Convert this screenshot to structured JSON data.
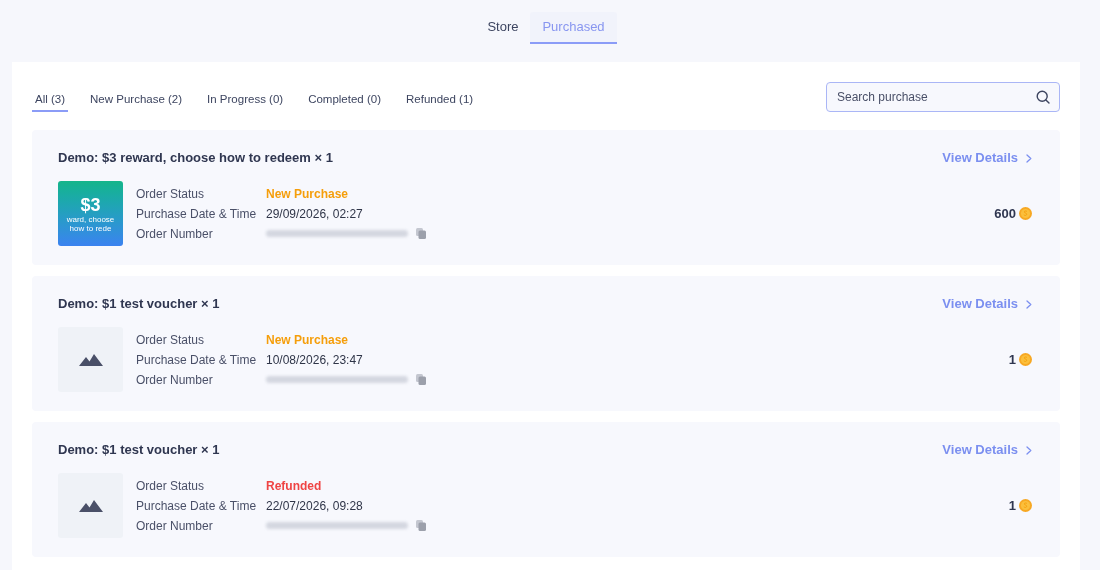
{
  "top_tabs": [
    {
      "label": "Store",
      "selected": false
    },
    {
      "label": "Purchased",
      "selected": true
    }
  ],
  "filter_tabs": [
    {
      "label": "All (3)",
      "selected": true
    },
    {
      "label": "New Purchase (2)",
      "selected": false
    },
    {
      "label": "In Progress (0)",
      "selected": false
    },
    {
      "label": "Completed (0)",
      "selected": false
    },
    {
      "label": "Refunded (1)",
      "selected": false
    }
  ],
  "search": {
    "placeholder": "Search purchase"
  },
  "orders": [
    {
      "title": "Demo: $3 reward, choose how to redeem × 1",
      "thumbnail": {
        "kind": "voucher",
        "amount": "$3",
        "caption": "ward, choose how to rede"
      },
      "fields": [
        {
          "kind": "status",
          "label": "Order Status",
          "value": "New Purchase",
          "color": "#f59e0b"
        },
        {
          "kind": "text",
          "label": "Purchase Date & Time",
          "value": "29/09/2026, 02:27"
        },
        {
          "kind": "redacted",
          "label": "Order Number"
        }
      ],
      "details_link": "View Details",
      "price": "600"
    },
    {
      "title": "Demo: $1 test voucher × 1",
      "thumbnail": {
        "kind": "placeholder"
      },
      "fields": [
        {
          "kind": "status",
          "label": "Order Status",
          "value": "New Purchase",
          "color": "#f59e0b"
        },
        {
          "kind": "text",
          "label": "Purchase Date & Time",
          "value": "10/08/2026, 23:47"
        },
        {
          "kind": "redacted",
          "label": "Order Number"
        }
      ],
      "details_link": "View Details",
      "price": "1"
    },
    {
      "title": "Demo: $1 test voucher × 1",
      "thumbnail": {
        "kind": "placeholder"
      },
      "fields": [
        {
          "kind": "status",
          "label": "Order Status",
          "value": "Refunded",
          "color": "#ef4444"
        },
        {
          "kind": "text",
          "label": "Purchase Date & Time",
          "value": "22/07/2026, 09:28"
        },
        {
          "kind": "redacted",
          "label": "Order Number"
        }
      ],
      "details_link": "View Details",
      "price": "1"
    }
  ]
}
